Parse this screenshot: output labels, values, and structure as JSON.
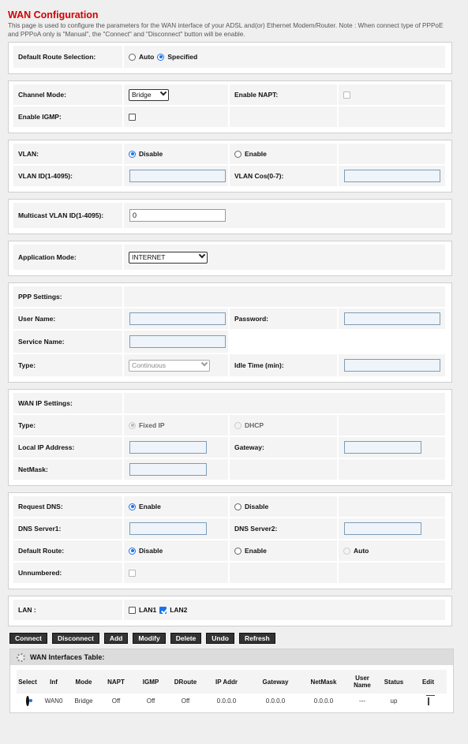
{
  "page": {
    "title": "WAN Configuration",
    "description": "This page is used to configure the parameters for the WAN interface of your ADSL and(or) Ethernet Modem/Router. Note : When connect type of PPPoE and PPPoA only is \"Manual\", the \"Connect\" and \"Disconnect\" button will be enable."
  },
  "default_route": {
    "label": "Default Route Selection:",
    "auto": "Auto",
    "specified": "Specified",
    "selected": "Specified"
  },
  "channel": {
    "mode_label": "Channel Mode:",
    "mode_value": "Bridge",
    "napt_label": "Enable NAPT:",
    "igmp_label": "Enable IGMP:"
  },
  "vlan": {
    "label": "VLAN:",
    "disable": "Disable",
    "enable": "Enable",
    "selected": "Disable",
    "id_label": "VLAN ID(1-4095):",
    "cos_label": "VLAN Cos(0-7):"
  },
  "multicast": {
    "label": "Multicast VLAN ID(1-4095):",
    "value": "0"
  },
  "application": {
    "label": "Application Mode:",
    "value": "INTERNET"
  },
  "ppp": {
    "section": "PPP Settings:",
    "user_label": "User Name:",
    "password_label": "Password:",
    "service_label": "Service Name:",
    "type_label": "Type:",
    "type_value": "Continuous",
    "idle_label": "Idle Time (min):"
  },
  "wan_ip": {
    "section": "WAN IP Settings:",
    "type_label": "Type:",
    "fixed": "Fixed IP",
    "dhcp": "DHCP",
    "local_label": "Local IP Address:",
    "gateway_label": "Gateway:",
    "netmask_label": "NetMask:"
  },
  "dns": {
    "request_label": "Request DNS:",
    "enable": "Enable",
    "disable": "Disable",
    "server1_label": "DNS Server1:",
    "server2_label": "DNS Server2:",
    "default_route_label": "Default Route:",
    "dr_disable": "Disable",
    "dr_enable": "Enable",
    "dr_auto": "Auto",
    "unnumbered_label": "Unnumbered:"
  },
  "lan": {
    "label": "LAN :",
    "lan1": "LAN1",
    "lan2": "LAN2"
  },
  "buttons": {
    "connect": "Connect",
    "disconnect": "Disconnect",
    "add": "Add",
    "modify": "Modify",
    "delete": "Delete",
    "undo": "Undo",
    "refresh": "Refresh"
  },
  "table": {
    "title": "WAN Interfaces Table:",
    "headers": [
      "Select",
      "Inf",
      "Mode",
      "NAPT",
      "IGMP",
      "DRoute",
      "IP Addr",
      "Gateway",
      "NetMask",
      "User Name",
      "Status",
      "Edit"
    ],
    "rows": [
      {
        "inf": "WAN0",
        "mode": "Bridge",
        "napt": "Off",
        "igmp": "Off",
        "droute": "Off",
        "ip": "0.0.0.0",
        "gateway": "0.0.0.0",
        "netmask": "0.0.0.0",
        "user": "---",
        "status": "up"
      }
    ]
  },
  "icons": {
    "gear": "gear-icon",
    "trash": "trash-icon"
  }
}
